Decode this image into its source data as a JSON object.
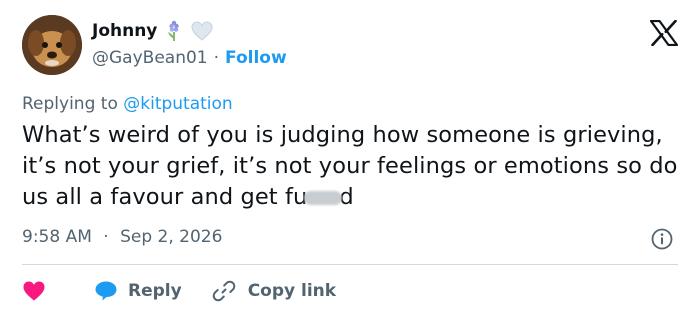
{
  "author": {
    "name": "Johnny",
    "handle": "@GayBean01",
    "follow_label": "Follow",
    "separator": "·"
  },
  "reply": {
    "prefix": "Replying to",
    "mention": "@kitputation"
  },
  "tweet": {
    "text_before_censor": "What’s weird of you is judging how someone is grieving, it’s not your grief, it’s not your feelings or emotions so do us all a favour and get fu",
    "text_after_censor": "d"
  },
  "meta": {
    "time": "9:58 AM",
    "separator": "·",
    "date": "Sep 2, 2026"
  },
  "actions": {
    "reply_label": "Reply",
    "copy_link_label": "Copy link"
  },
  "icons": {
    "x_logo": "x-logo-icon",
    "info": "info-icon",
    "heart": "heart-icon",
    "reply": "speech-bubble-icon",
    "link": "link-icon",
    "hyacinth": "hyacinth-emoji",
    "heart_emoji": "white-heart-emoji"
  },
  "colors": {
    "accent": "#1d9bf0",
    "like": "#f91880",
    "muted": "#536471",
    "text": "#0f1419"
  }
}
